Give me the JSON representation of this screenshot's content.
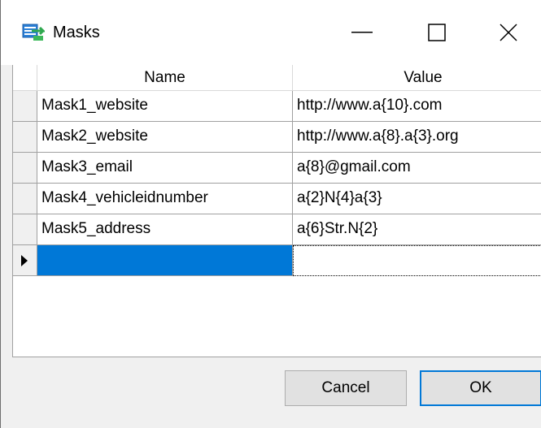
{
  "window": {
    "title": "Masks",
    "icon": "masks-app-icon"
  },
  "controls": {
    "minimize": "minimize-icon",
    "maximize": "maximize-icon",
    "close": "close-icon"
  },
  "grid": {
    "columns": [
      "Name",
      "Value"
    ],
    "rows": [
      {
        "name": "Mask1_website",
        "value": "http://www.a{10}.com"
      },
      {
        "name": "Mask2_website",
        "value": "http://www.a{8}.a{3}.org"
      },
      {
        "name": "Mask3_email",
        "value": "a{8}@gmail.com"
      },
      {
        "name": "Mask4_vehicleidnumber",
        "value": "a{2}N{4}a{3}"
      },
      {
        "name": "Mask5_address",
        "value": "a{6}Str.N{2}"
      }
    ],
    "new_row": {
      "name": "",
      "value": ""
    }
  },
  "buttons": {
    "cancel": "Cancel",
    "ok": "OK"
  },
  "colors": {
    "selection": "#0078d7",
    "default_button_border": "#0078d7"
  }
}
